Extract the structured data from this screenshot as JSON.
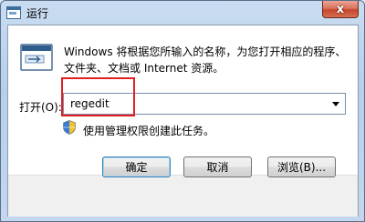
{
  "window": {
    "title": "运行"
  },
  "titlebar": {
    "close_glyph": "x",
    "close_icon": "close-icon"
  },
  "icons": {
    "app": "run-app-icon",
    "main": "run-dialog-icon",
    "shield": "uac-shield-icon"
  },
  "dialog": {
    "description_line1": "Windows 将根据您所输入的名称，为您打开相应的程序、",
    "description_line2": "文件夹、文档或 Internet 资源。",
    "open_label": "打开(O):",
    "open_value": "regedit",
    "admin_note": "使用管理权限创建此任务。"
  },
  "buttons": {
    "ok": "确定",
    "cancel": "取消",
    "browse": "浏览(B)..."
  },
  "colors": {
    "highlight": "#e02020",
    "titlebar": "#b7cfe9",
    "close": "#c9452c"
  }
}
